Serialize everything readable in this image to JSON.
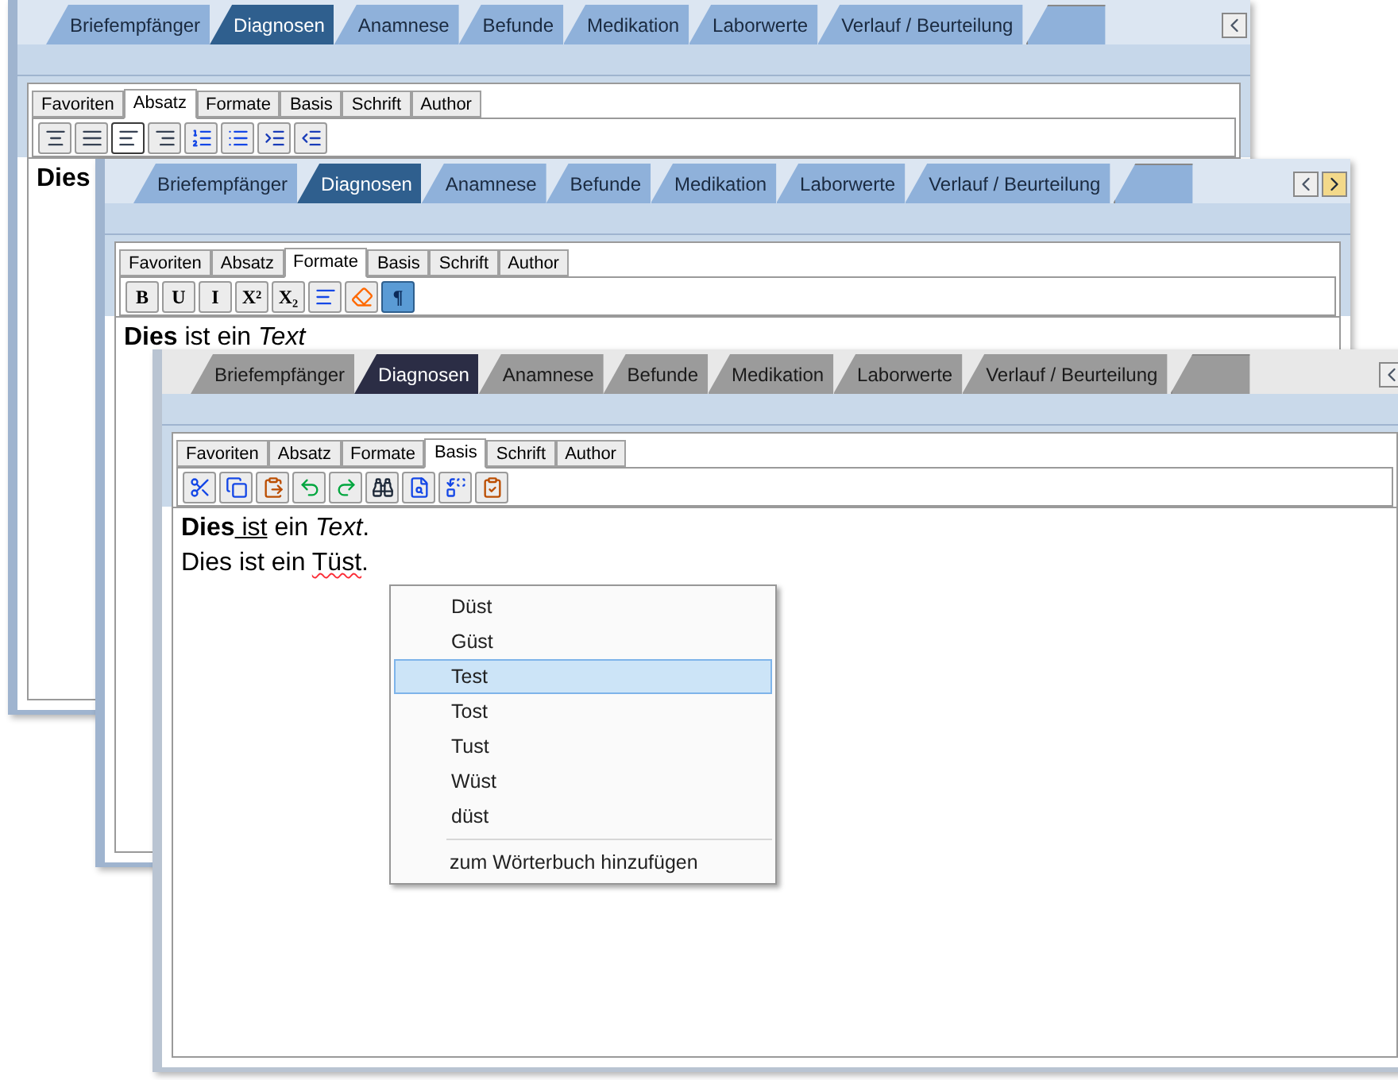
{
  "windows": [
    {
      "kind": "blue",
      "tabs": [
        {
          "label": "Briefempfänger",
          "selected": false
        },
        {
          "label": "Diagnosen",
          "selected": true
        },
        {
          "label": "Anamnese",
          "selected": false
        },
        {
          "label": "Befunde",
          "selected": false
        },
        {
          "label": "Medikation",
          "selected": false
        },
        {
          "label": "Laborwerte",
          "selected": false
        },
        {
          "label": "Verlauf / Beurteilung",
          "selected": false
        }
      ],
      "ribbon_tabs": [
        {
          "label": "Favoriten",
          "selected": false
        },
        {
          "label": "Absatz",
          "selected": true
        },
        {
          "label": "Formate",
          "selected": false
        },
        {
          "label": "Basis",
          "selected": false
        },
        {
          "label": "Schrift",
          "selected": false
        },
        {
          "label": "Author",
          "selected": false
        }
      ],
      "toolbar": [
        {
          "kind": "align-center",
          "pressed": false
        },
        {
          "kind": "align-justify",
          "pressed": false
        },
        {
          "kind": "align-left",
          "pressed": true
        },
        {
          "kind": "align-right",
          "pressed": false
        },
        {
          "kind": "numbered-list",
          "pressed": false
        },
        {
          "kind": "bullet-list",
          "pressed": false
        },
        {
          "kind": "indent",
          "pressed": false
        },
        {
          "kind": "outdent",
          "pressed": false
        }
      ],
      "lines": [
        {
          "runs": [
            {
              "text": "Dies",
              "bold": true,
              "italic": false,
              "underline": false,
              "misspelled": false
            }
          ]
        }
      ]
    },
    {
      "kind": "blue",
      "tabs": [
        {
          "label": "Briefempfänger",
          "selected": false
        },
        {
          "label": "Diagnosen",
          "selected": true
        },
        {
          "label": "Anamnese",
          "selected": false
        },
        {
          "label": "Befunde",
          "selected": false
        },
        {
          "label": "Medikation",
          "selected": false
        },
        {
          "label": "Laborwerte",
          "selected": false
        },
        {
          "label": "Verlauf / Beurteilung",
          "selected": false
        }
      ],
      "ribbon_tabs": [
        {
          "label": "Favoriten",
          "selected": false
        },
        {
          "label": "Absatz",
          "selected": false
        },
        {
          "label": "Formate",
          "selected": true
        },
        {
          "label": "Basis",
          "selected": false
        },
        {
          "label": "Schrift",
          "selected": false
        },
        {
          "label": "Author",
          "selected": false
        }
      ],
      "toolbar": [
        {
          "kind": "text",
          "label": "B",
          "pressed": false
        },
        {
          "kind": "text",
          "label": "U",
          "pressed": false
        },
        {
          "kind": "text",
          "label": "I",
          "pressed": false
        },
        {
          "kind": "text",
          "label": "X²",
          "pressed": false
        },
        {
          "kind": "text",
          "label": "X₂",
          "pressed": false
        },
        {
          "kind": "text-lines",
          "pressed": false
        },
        {
          "kind": "eraser",
          "pressed": false
        },
        {
          "kind": "text",
          "label": "¶",
          "pressed": true
        }
      ],
      "lines": [
        {
          "runs": [
            {
              "text": "Dies",
              "bold": true,
              "italic": false,
              "underline": false,
              "misspelled": false
            },
            {
              "text": " ist ein ",
              "bold": false,
              "italic": false,
              "underline": false,
              "misspelled": false
            },
            {
              "text": "Text",
              "bold": false,
              "italic": true,
              "underline": false,
              "misspelled": false
            }
          ]
        }
      ]
    },
    {
      "kind": "gray",
      "tabs": [
        {
          "label": "Briefempfänger",
          "selected": false
        },
        {
          "label": "Diagnosen",
          "selected": true
        },
        {
          "label": "Anamnese",
          "selected": false
        },
        {
          "label": "Befunde",
          "selected": false
        },
        {
          "label": "Medikation",
          "selected": false
        },
        {
          "label": "Laborwerte",
          "selected": false
        },
        {
          "label": "Verlauf / Beurteilung",
          "selected": false
        }
      ],
      "ribbon_tabs": [
        {
          "label": "Favoriten",
          "selected": false
        },
        {
          "label": "Absatz",
          "selected": false
        },
        {
          "label": "Formate",
          "selected": false
        },
        {
          "label": "Basis",
          "selected": true
        },
        {
          "label": "Schrift",
          "selected": false
        },
        {
          "label": "Author",
          "selected": false
        }
      ],
      "toolbar": [
        {
          "kind": "scissors",
          "pressed": false
        },
        {
          "kind": "copy",
          "pressed": false
        },
        {
          "kind": "clipboard",
          "pressed": false
        },
        {
          "kind": "undo",
          "pressed": false
        },
        {
          "kind": "redo",
          "pressed": false
        },
        {
          "kind": "binoculars",
          "pressed": false
        },
        {
          "kind": "file-search",
          "pressed": false
        },
        {
          "kind": "replace",
          "pressed": false
        },
        {
          "kind": "clipboard-check",
          "pressed": false
        }
      ],
      "lines": [
        {
          "runs": [
            {
              "text": "Dies",
              "bold": true,
              "italic": false,
              "underline": false,
              "misspelled": false
            },
            {
              "text": " ist",
              "bold": false,
              "italic": false,
              "underline": true,
              "misspelled": false
            },
            {
              "text": " ein ",
              "bold": false,
              "italic": false,
              "underline": false,
              "misspelled": false
            },
            {
              "text": "Text",
              "bold": false,
              "italic": true,
              "underline": false,
              "misspelled": false
            },
            {
              "text": ".",
              "bold": false,
              "italic": false,
              "underline": false,
              "misspelled": false
            }
          ]
        },
        {
          "runs": [
            {
              "text": "Dies ist ein ",
              "bold": false,
              "italic": false,
              "underline": false,
              "misspelled": false
            },
            {
              "text": "Tüst",
              "bold": false,
              "italic": false,
              "underline": false,
              "misspelled": true
            },
            {
              "text": ".",
              "bold": false,
              "italic": false,
              "underline": false,
              "misspelled": false
            }
          ]
        }
      ]
    }
  ],
  "context_menu": {
    "suggestions": [
      {
        "label": "Düst",
        "selected": false
      },
      {
        "label": "Güst",
        "selected": false
      },
      {
        "label": "Test",
        "selected": true
      },
      {
        "label": "Tost",
        "selected": false
      },
      {
        "label": "Tust",
        "selected": false
      },
      {
        "label": "Wüst",
        "selected": false
      },
      {
        "label": "düst",
        "selected": false
      }
    ],
    "add_to_dictionary": "zum Wörterbuch hinzufügen"
  }
}
